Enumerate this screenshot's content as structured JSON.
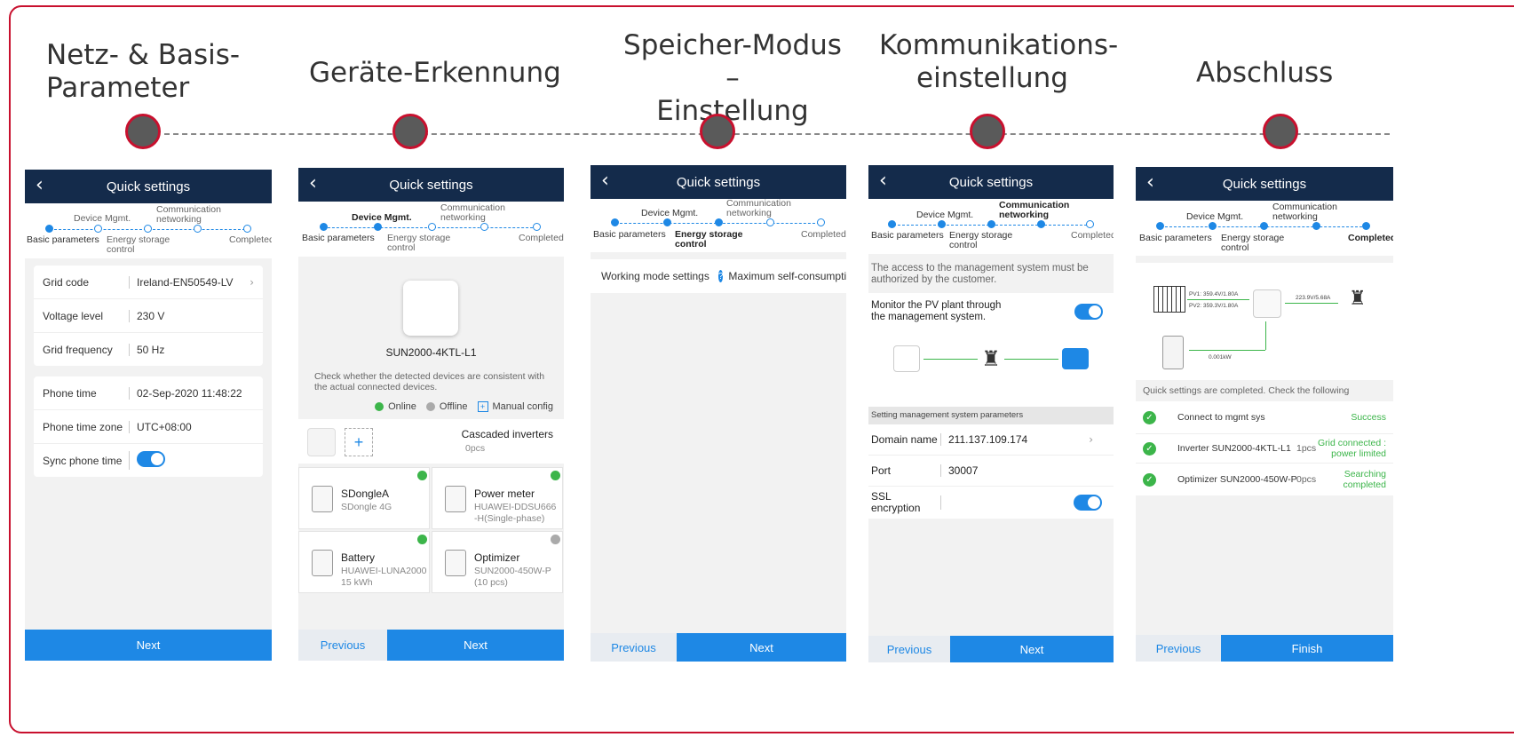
{
  "phases": [
    {
      "title": "Netz- & Basis-\nParameter"
    },
    {
      "title": "Geräte-Erkennung"
    },
    {
      "title": "Speicher-Modus –\nEinstellung"
    },
    {
      "title": "Kommunikations-\neinstellung"
    },
    {
      "title": "Abschluss"
    }
  ],
  "screen_title": "Quick settings",
  "steps": {
    "s1": "Basic parameters",
    "s2": "Device Mgmt.",
    "s3a": "Energy storage",
    "s3b": "control",
    "s4a": "Communication",
    "s4b": "networking",
    "s5": "Completed"
  },
  "screen1": {
    "card1": [
      {
        "label": "Grid code",
        "value": "Ireland-EN50549-LV"
      },
      {
        "label": "Voltage level",
        "value": "230 V"
      },
      {
        "label": "Grid frequency",
        "value": "50 Hz"
      }
    ],
    "card2": [
      {
        "label": "Phone time",
        "value": "02-Sep-2020 11:48:22"
      },
      {
        "label": "Phone time zone",
        "value": "UTC+08:00"
      },
      {
        "label": "Sync phone time",
        "value": ""
      }
    ],
    "next": "Next"
  },
  "screen2": {
    "device_model": "SUN2000-4KTL-L1",
    "hint": "Check whether the detected devices are consistent with the actual connected devices.",
    "legend_online": "Online",
    "legend_offline": "Offline",
    "legend_manual": "Manual config",
    "cascaded_label": "Cascaded inverters",
    "cascaded_count": "0pcs",
    "devices": [
      {
        "name": "SDongleA",
        "sub": "SDongle 4G",
        "status": "online"
      },
      {
        "name": "Power meter",
        "sub": "HUAWEI-DDSU666\n-H(Single-phase)",
        "status": "online"
      },
      {
        "name": "Battery",
        "sub": "HUAWEI-LUNA2000\n15 kWh",
        "status": "online"
      },
      {
        "name": "Optimizer",
        "sub": "SUN2000-450W-P\n(10 pcs)",
        "status": "offline"
      }
    ],
    "prev": "Previous",
    "next": "Next"
  },
  "screen3": {
    "mode_label": "Working mode settings",
    "mode_value": "Maximum self-consumptio",
    "prev": "Previous",
    "next": "Next"
  },
  "screen4": {
    "notice": "The access to the management system must be authorized by the customer.",
    "monitor_text": "Monitor the PV plant through the management system.",
    "section": "Setting management system parameters",
    "domain_label": "Domain name",
    "domain_value": "211.137.109.174",
    "port_label": "Port",
    "port_value": "30007",
    "ssl_label": "SSL\nencryption",
    "prev": "Previous",
    "next": "Next"
  },
  "screen5": {
    "pv1": "PV1: 359.4V/1.80A",
    "pv2": "PV2: 359.3V/1.80A",
    "grid_flow": "223.9V/5.68A",
    "battery_flow": "0.001kW",
    "summary": "Quick settings are completed. Check the following",
    "checks": [
      {
        "item": "Connect to mgmt sys",
        "count": "",
        "status": "Success"
      },
      {
        "item": "Inverter SUN2000-4KTL-L1",
        "count": "1pcs",
        "status": "Grid connected :\npower limited"
      },
      {
        "item": "Optimizer SUN2000-450W-P",
        "count": "0pcs",
        "status": "Searching\ncompleted"
      }
    ],
    "prev": "Previous",
    "finish": "Finish"
  },
  "colors": {
    "accent": "#c8102e",
    "header": "#142b4b",
    "primary": "#1e88e5",
    "ok": "#3cb54a"
  }
}
